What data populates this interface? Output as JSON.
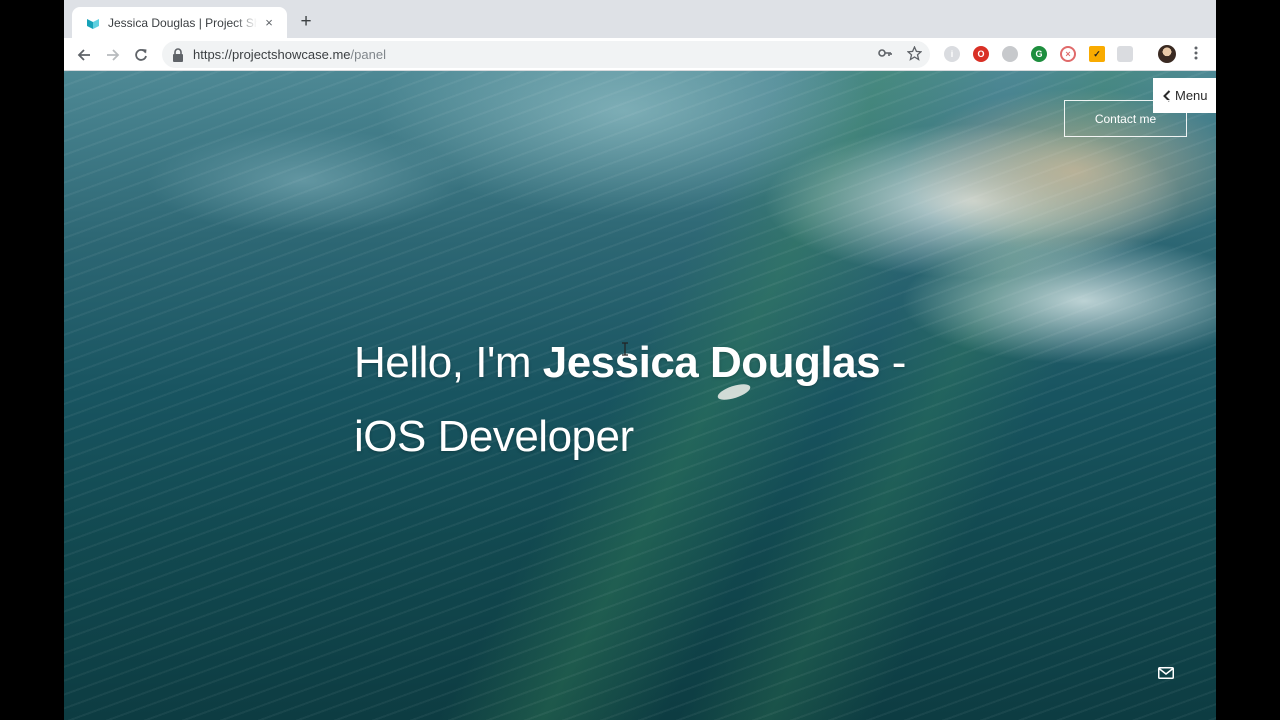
{
  "browser": {
    "tab_title": "Jessica Douglas | Project Showcase",
    "tab_close": "×",
    "new_tab": "+",
    "url_host": "https://projectshowcase.me",
    "url_path": "/panel"
  },
  "page": {
    "menu_label": "Menu",
    "contact_label": "Contact me",
    "hero": {
      "greeting": "Hello, I'm ",
      "name": "Jessica Douglas",
      "dash": " -",
      "role": "iOS Developer"
    }
  },
  "colors": {
    "tab_strip": "#dee1e6",
    "accent": "#17a2b8",
    "extension_red": "#d93025",
    "extension_green": "#1e8e3e",
    "extension_yellow": "#f9ab00"
  }
}
